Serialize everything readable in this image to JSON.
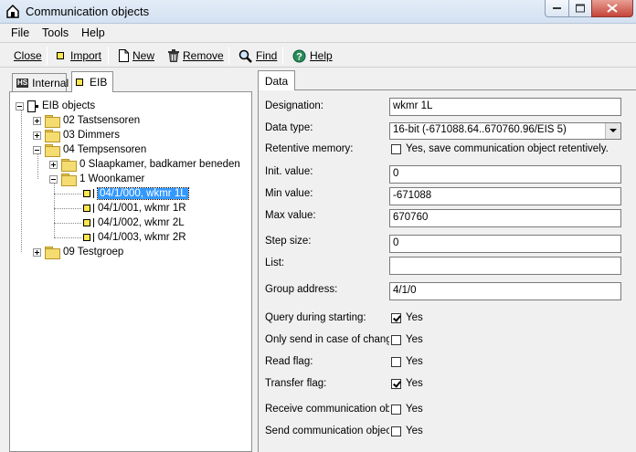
{
  "window": {
    "title": "Communication objects"
  },
  "menu": {
    "file": "File",
    "tools": "Tools",
    "help": "Help"
  },
  "toolbar": {
    "close": "Close",
    "import": "Import",
    "new": "New",
    "remove": "Remove",
    "find": "Find",
    "help": "Help"
  },
  "left_tabs": {
    "internal": "Internal",
    "eib": "EIB",
    "internal_badge": "HS"
  },
  "tree": {
    "root": "EIB objects",
    "g02": "02 Tastsensoren",
    "g03": "03 Dimmers",
    "g04": "04 Tempsensoren",
    "g04_0": "0 Slaapkamer, badkamer beneden",
    "g04_1": "1 Woonkamer",
    "obj1": "04/1/000, wkmr 1L",
    "obj2": "04/1/001, wkmr 1R",
    "obj3": "04/1/002, wkmr 2L",
    "obj4": "04/1/003, wkmr 2R",
    "g09": "09 Testgroep"
  },
  "right_tab": {
    "data": "Data"
  },
  "form": {
    "designation_label": "Designation:",
    "designation_value": "wkmr 1L",
    "datatype_label": "Data type:",
    "datatype_value": "16-bit (-671088.64..670760.96/EIS 5)",
    "retentive_label": "Retentive memory:",
    "retentive_text": "Yes, save communication object retentively.",
    "retentive_checked": false,
    "init_label": "Init. value:",
    "init_value": "0",
    "min_label": "Min value:",
    "min_value": "-671088",
    "max_label": "Max value:",
    "max_value": "670760",
    "step_label": "Step size:",
    "step_value": "0",
    "list_label": "List:",
    "list_value": "",
    "group_label": "Group address:",
    "group_value": "4/1/0",
    "query_label": "Query during starting:",
    "query_text": "Yes",
    "query_checked": true,
    "onlysend_label": "Only send in case of change",
    "onlysend_text": "Yes",
    "onlysend_checked": false,
    "read_label": "Read flag:",
    "read_text": "Yes",
    "read_checked": false,
    "transfer_label": "Transfer flag:",
    "transfer_text": "Yes",
    "transfer_checked": true,
    "receive_label": "Receive communication obje",
    "receive_text": "Yes",
    "receive_checked": false,
    "sendobj_label": "Send communication object",
    "sendobj_text": "Yes",
    "sendobj_checked": false
  },
  "icons": {
    "app": "house-icon",
    "import": "object-icon",
    "new": "new-document-icon",
    "remove": "trash-icon",
    "find": "magnifier-icon",
    "help": "help-circle-icon"
  },
  "colors": {
    "selection": "#3399ff",
    "object_icon": "#ffe74d",
    "folder": "#f5dc70",
    "close_button": "#c5443a"
  }
}
